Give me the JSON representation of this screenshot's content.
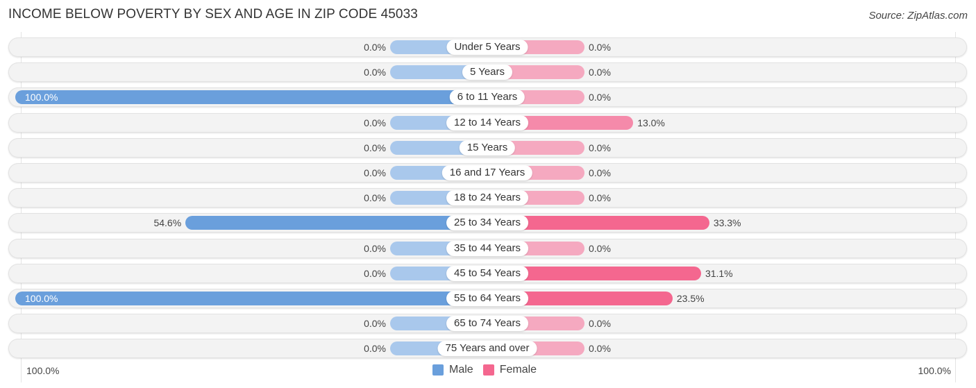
{
  "title": "INCOME BELOW POVERTY BY SEX AND AGE IN ZIP CODE 45033",
  "source": "Source: ZipAtlas.com",
  "axis": {
    "left_label": "100.0%",
    "right_label": "100.0%"
  },
  "legend": [
    {
      "name": "Male",
      "color": "#6a9fdc"
    },
    {
      "name": "Female",
      "color": "#f4678f"
    }
  ],
  "chart_data": {
    "type": "bar",
    "orientation": "horizontal-diverging",
    "title": "INCOME BELOW POVERTY BY SEX AND AGE IN ZIP CODE 45033",
    "xlim": [
      -100,
      100
    ],
    "categories": [
      "Under 5 Years",
      "5 Years",
      "6 to 11 Years",
      "12 to 14 Years",
      "15 Years",
      "16 and 17 Years",
      "18 to 24 Years",
      "25 to 34 Years",
      "35 to 44 Years",
      "45 to 54 Years",
      "55 to 64 Years",
      "65 to 74 Years",
      "75 Years and over"
    ],
    "series": [
      {
        "name": "Male",
        "values": [
          0.0,
          0.0,
          100.0,
          0.0,
          0.0,
          0.0,
          0.0,
          54.6,
          0.0,
          0.0,
          100.0,
          0.0,
          0.0
        ],
        "labels": [
          "0.0%",
          "0.0%",
          "100.0%",
          "0.0%",
          "0.0%",
          "0.0%",
          "0.0%",
          "54.6%",
          "0.0%",
          "0.0%",
          "100.0%",
          "0.0%",
          "0.0%"
        ]
      },
      {
        "name": "Female",
        "values": [
          0.0,
          0.0,
          0.0,
          13.0,
          0.0,
          0.0,
          0.0,
          33.3,
          0.0,
          31.1,
          23.5,
          0.0,
          0.0
        ],
        "labels": [
          "0.0%",
          "0.0%",
          "0.0%",
          "13.0%",
          "0.0%",
          "0.0%",
          "0.0%",
          "33.3%",
          "0.0%",
          "31.1%",
          "23.5%",
          "0.0%",
          "0.0%"
        ]
      }
    ]
  }
}
